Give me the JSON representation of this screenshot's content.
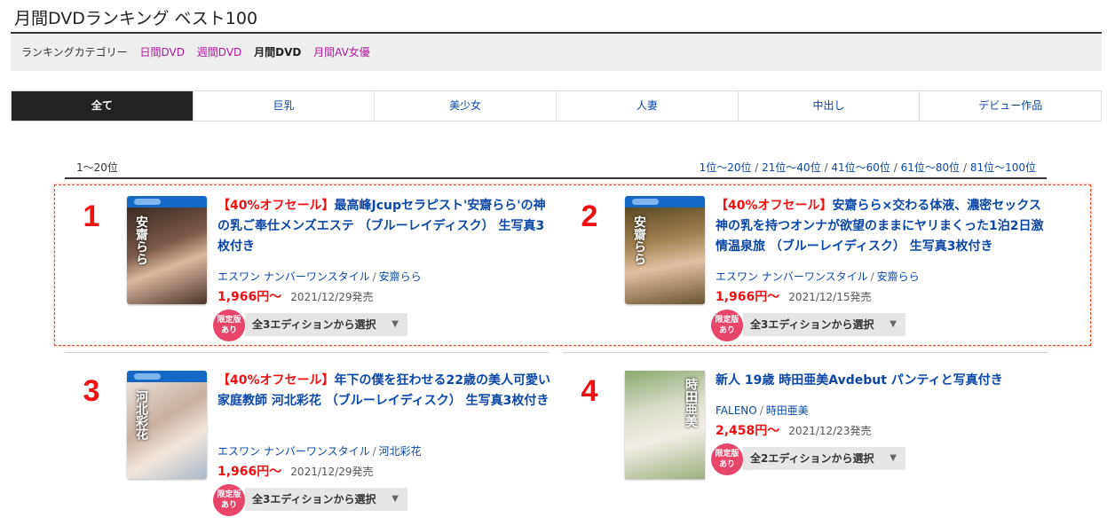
{
  "page_title": "月間DVDランキング ベスト100",
  "category_bar": {
    "label": "ランキングカテゴリー",
    "links": [
      {
        "label": "日間DVD",
        "current": false
      },
      {
        "label": "週間DVD",
        "current": false
      },
      {
        "label": "月間DVD",
        "current": true
      },
      {
        "label": "月間AV女優",
        "current": false
      }
    ]
  },
  "tabs": [
    {
      "label": "全て",
      "active": true
    },
    {
      "label": "巨乳",
      "active": false
    },
    {
      "label": "美少女",
      "active": false
    },
    {
      "label": "人妻",
      "active": false
    },
    {
      "label": "中出し",
      "active": false
    },
    {
      "label": "デビュー作品",
      "active": false
    }
  ],
  "range": {
    "current": "1〜20位",
    "links": [
      "1位〜20位",
      "21位〜40位",
      "41位〜60位",
      "61位〜80位",
      "81位〜100位"
    ],
    "separator": " / "
  },
  "items": [
    {
      "rank": "1",
      "sale": "【40%オフセール】",
      "title": "最高峰Jcupセラピスト'安齋らら'の神の乳ご奉仕メンズエステ （ブルーレイディスク） 生写真3枚付き",
      "maker": "エスワン ナンバーワンスタイル",
      "actress": "安齋らら",
      "price": "1,966円〜",
      "release": "2021/12/29発売",
      "badge_line1": "限定版",
      "badge_line2": "あり",
      "editions": "全3エディションから選択",
      "cover_text": "安齋らら",
      "cover_color": "#6a4a3a"
    },
    {
      "rank": "2",
      "sale": "【40%オフセール】",
      "title": "安齋らら×交わる体液、濃密セックス 神の乳を持つオンナが欲望のままにヤリまくった1泊2日激情温泉旅 （ブルーレイディスク） 生写真3枚付き",
      "maker": "エスワン ナンバーワンスタイル",
      "actress": "安齋らら",
      "price": "1,966円〜",
      "release": "2021/12/15発売",
      "badge_line1": "限定版",
      "badge_line2": "あり",
      "editions": "全3エディションから選択",
      "cover_text": "安齋らら",
      "cover_color": "#8a6a3a"
    },
    {
      "rank": "3",
      "sale": "【40%オフセール】",
      "title": "年下の僕を狂わせる22歳の美人可愛い家庭教師 河北彩花 （ブルーレイディスク） 生写真3枚付き",
      "maker": "エスワン ナンバーワンスタイル",
      "actress": "河北彩花",
      "price": "1,966円〜",
      "release": "2021/12/29発売",
      "badge_line1": "限定版",
      "badge_line2": "あり",
      "editions": "全3エディションから選択",
      "cover_text": "河北彩花",
      "cover_color": "#c8b8a8"
    },
    {
      "rank": "4",
      "sale": "",
      "title": "新人 19歳 時田亜美Avdebut パンティと写真付き",
      "maker": "FALENO",
      "actress": "時田亜美",
      "price": "2,458円〜",
      "release": "2021/12/23発売",
      "badge_line1": "限定版",
      "badge_line2": "あり",
      "editions": "全2エディションから選択",
      "cover_text": "時田亜美",
      "cover_color": "#b8c8a8"
    }
  ],
  "colors": {
    "accent_red": "#e11111",
    "link_blue": "#0b47a7",
    "category_link": "#b0179b",
    "badge_pink": "#e8456b",
    "highlight_border": "#e8452c"
  }
}
